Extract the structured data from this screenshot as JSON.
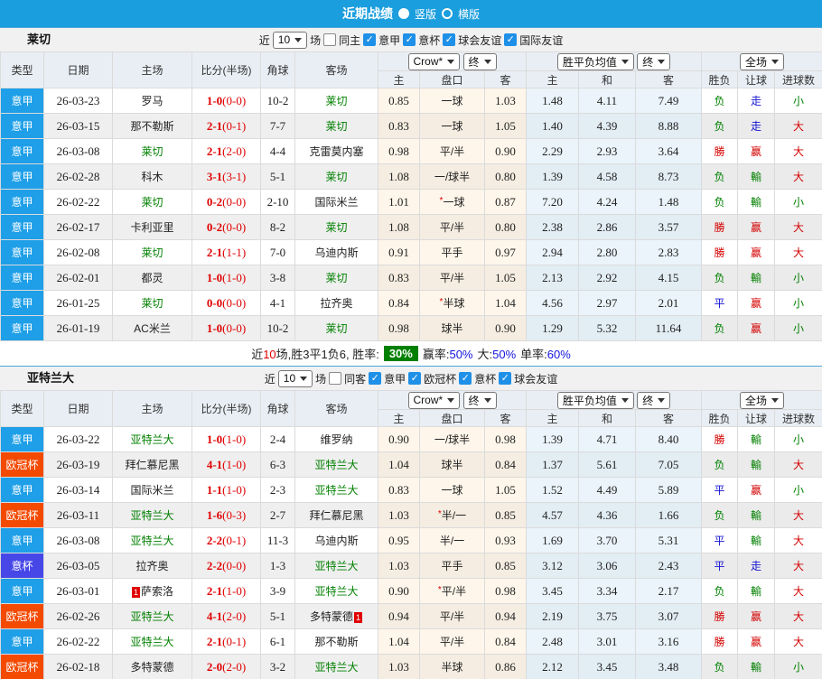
{
  "colors": {
    "titlebar": "#1B9EDE",
    "league": {
      "意甲": "#1E9FE8",
      "欧冠杯": "#F34A00",
      "意杯": "#4747E8"
    },
    "focus_team": "#008000",
    "score": "#E00000",
    "result_red": "#D40000",
    "result_green": "#008000",
    "result_blue": "#1414D4",
    "win_rate_badge": "#008000"
  },
  "title": {
    "text": "近期战绩",
    "vertical_label": "竖版",
    "horizontal_label": "横版"
  },
  "table_header": {
    "cols": [
      "类型",
      "日期",
      "主场",
      "比分(半场)",
      "角球",
      "客场"
    ],
    "sub": [
      "主",
      "盘口",
      "客",
      "主",
      "和",
      "客",
      "胜负",
      "让球",
      "进球数"
    ],
    "dropdowns": {
      "bookmaker": "Crow*",
      "final_a": "终",
      "average": "胜平负均值",
      "final_b": "终",
      "scope": "全场"
    }
  },
  "sections": [
    {
      "team": "莱切",
      "filters": {
        "near": "近",
        "count": "10",
        "games": "场",
        "same": "同主",
        "leagues": [
          "意甲",
          "意杯",
          "球会友谊",
          "国际友谊"
        ]
      },
      "rows": [
        {
          "league": "意甲",
          "date": "26-03-23",
          "home": "罗马",
          "score": "1-0",
          "half": "(0-0)",
          "corner": "10-2",
          "away": "莱切",
          "away_focus": true,
          "odds_home": "0.85",
          "handicap": "一球",
          "odds_away": "1.03",
          "avg_win": "1.48",
          "avg_draw": "4.11",
          "avg_lose": "7.49",
          "res_outcome": "负",
          "res_handicap": "走",
          "res_goals": "小"
        },
        {
          "league": "意甲",
          "date": "26-03-15",
          "home": "那不勒斯",
          "score": "2-1",
          "half": "(0-1)",
          "corner": "7-7",
          "away": "莱切",
          "away_focus": true,
          "odds_home": "0.83",
          "handicap": "一球",
          "odds_away": "1.05",
          "avg_win": "1.40",
          "avg_draw": "4.39",
          "avg_lose": "8.88",
          "res_outcome": "负",
          "res_handicap": "走",
          "res_goals": "大"
        },
        {
          "league": "意甲",
          "date": "26-03-08",
          "home": "莱切",
          "home_focus": true,
          "score": "2-1",
          "half": "(2-0)",
          "corner": "4-4",
          "away": "克雷莫内塞",
          "odds_home": "0.98",
          "handicap": "平/半",
          "odds_away": "0.90",
          "avg_win": "2.29",
          "avg_draw": "2.93",
          "avg_lose": "3.64",
          "res_outcome": "勝",
          "res_handicap": "赢",
          "res_goals": "大"
        },
        {
          "league": "意甲",
          "date": "26-02-28",
          "home": "科木",
          "score": "3-1",
          "half": "(3-1)",
          "corner": "5-1",
          "away": "莱切",
          "away_focus": true,
          "odds_home": "1.08",
          "handicap": "一/球半",
          "odds_away": "0.80",
          "avg_win": "1.39",
          "avg_draw": "4.58",
          "avg_lose": "8.73",
          "res_outcome": "负",
          "res_handicap": "輸",
          "res_goals": "大"
        },
        {
          "league": "意甲",
          "date": "26-02-22",
          "home": "莱切",
          "home_focus": true,
          "score": "0-2",
          "half": "(0-0)",
          "corner": "2-10",
          "away": "国际米兰",
          "odds_home": "1.01",
          "handicap": "一球",
          "handicap_star": true,
          "odds_away": "0.87",
          "avg_win": "7.20",
          "avg_draw": "4.24",
          "avg_lose": "1.48",
          "res_outcome": "负",
          "res_handicap": "輸",
          "res_goals": "小"
        },
        {
          "league": "意甲",
          "date": "26-02-17",
          "home": "卡利亚里",
          "score": "0-2",
          "half": "(0-0)",
          "corner": "8-2",
          "away": "莱切",
          "away_focus": true,
          "odds_home": "1.08",
          "handicap": "平/半",
          "odds_away": "0.80",
          "avg_win": "2.38",
          "avg_draw": "2.86",
          "avg_lose": "3.57",
          "res_outcome": "勝",
          "res_handicap": "赢",
          "res_goals": "大"
        },
        {
          "league": "意甲",
          "date": "26-02-08",
          "home": "莱切",
          "home_focus": true,
          "score": "2-1",
          "half": "(1-1)",
          "corner": "7-0",
          "away": "乌迪内斯",
          "odds_home": "0.91",
          "handicap": "平手",
          "odds_away": "0.97",
          "avg_win": "2.94",
          "avg_draw": "2.80",
          "avg_lose": "2.83",
          "res_outcome": "勝",
          "res_handicap": "赢",
          "res_goals": "大"
        },
        {
          "league": "意甲",
          "date": "26-02-01",
          "home": "都灵",
          "score": "1-0",
          "half": "(1-0)",
          "corner": "3-8",
          "away": "莱切",
          "away_focus": true,
          "odds_home": "0.83",
          "handicap": "平/半",
          "odds_away": "1.05",
          "avg_win": "2.13",
          "avg_draw": "2.92",
          "avg_lose": "4.15",
          "res_outcome": "负",
          "res_handicap": "輸",
          "res_goals": "小"
        },
        {
          "league": "意甲",
          "date": "26-01-25",
          "home": "莱切",
          "home_focus": true,
          "score": "0-0",
          "half": "(0-0)",
          "corner": "4-1",
          "away": "拉齐奥",
          "odds_home": "0.84",
          "handicap": "半球",
          "handicap_star": true,
          "odds_away": "1.04",
          "avg_win": "4.56",
          "avg_draw": "2.97",
          "avg_lose": "2.01",
          "res_outcome": "平",
          "res_handicap": "赢",
          "res_goals": "小"
        },
        {
          "league": "意甲",
          "date": "26-01-19",
          "home": "AC米兰",
          "score": "1-0",
          "half": "(0-0)",
          "corner": "10-2",
          "away": "莱切",
          "away_focus": true,
          "odds_home": "0.98",
          "handicap": "球半",
          "odds_away": "0.90",
          "avg_win": "1.29",
          "avg_draw": "5.32",
          "avg_lose": "11.64",
          "res_outcome": "负",
          "res_handicap": "赢",
          "res_goals": "小"
        }
      ],
      "summary": {
        "near": "近",
        "count": "10",
        "mid": "场,胜3平1负6, 胜率:",
        "win_rate": "30%",
        "parts": [
          {
            "label": "赢率:",
            "value": "50%"
          },
          {
            "label": "大:",
            "value": "50%"
          },
          {
            "label": "单率:",
            "value": "60%"
          }
        ]
      }
    },
    {
      "team": "亚特兰大",
      "filters": {
        "near": "近",
        "count": "10",
        "games": "场",
        "same": "同客",
        "leagues": [
          "意甲",
          "欧冠杯",
          "意杯",
          "球会友谊"
        ]
      },
      "rows": [
        {
          "league": "意甲",
          "date": "26-03-22",
          "home": "亚特兰大",
          "home_focus": true,
          "score": "1-0",
          "half": "(1-0)",
          "corner": "2-4",
          "away": "维罗纳",
          "odds_home": "0.90",
          "handicap": "一/球半",
          "odds_away": "0.98",
          "avg_win": "1.39",
          "avg_draw": "4.71",
          "avg_lose": "8.40",
          "res_outcome": "勝",
          "res_handicap": "輸",
          "res_goals": "小"
        },
        {
          "league": "欧冠杯",
          "date": "26-03-19",
          "home": "拜仁慕尼黑",
          "score": "4-1",
          "half": "(1-0)",
          "corner": "6-3",
          "away": "亚特兰大",
          "away_focus": true,
          "odds_home": "1.04",
          "handicap": "球半",
          "odds_away": "0.84",
          "avg_win": "1.37",
          "avg_draw": "5.61",
          "avg_lose": "7.05",
          "res_outcome": "负",
          "res_handicap": "輸",
          "res_goals": "大"
        },
        {
          "league": "意甲",
          "date": "26-03-14",
          "home": "国际米兰",
          "score": "1-1",
          "half": "(1-0)",
          "corner": "2-3",
          "away": "亚特兰大",
          "away_focus": true,
          "odds_home": "0.83",
          "handicap": "一球",
          "odds_away": "1.05",
          "avg_win": "1.52",
          "avg_draw": "4.49",
          "avg_lose": "5.89",
          "res_outcome": "平",
          "res_handicap": "赢",
          "res_goals": "小"
        },
        {
          "league": "欧冠杯",
          "date": "26-03-11",
          "home": "亚特兰大",
          "home_focus": true,
          "score": "1-6",
          "half": "(0-3)",
          "corner": "2-7",
          "away": "拜仁慕尼黑",
          "odds_home": "1.03",
          "handicap": "半/一",
          "handicap_star": true,
          "odds_away": "0.85",
          "avg_win": "4.57",
          "avg_draw": "4.36",
          "avg_lose": "1.66",
          "res_outcome": "负",
          "res_handicap": "輸",
          "res_goals": "大"
        },
        {
          "league": "意甲",
          "date": "26-03-08",
          "home": "亚特兰大",
          "home_focus": true,
          "score": "2-2",
          "half": "(0-1)",
          "corner": "11-3",
          "away": "乌迪内斯",
          "odds_home": "0.95",
          "handicap": "半/一",
          "odds_away": "0.93",
          "avg_win": "1.69",
          "avg_draw": "3.70",
          "avg_lose": "5.31",
          "res_outcome": "平",
          "res_handicap": "輸",
          "res_goals": "大"
        },
        {
          "league": "意杯",
          "date": "26-03-05",
          "home": "拉齐奥",
          "score": "2-2",
          "half": "(0-0)",
          "corner": "1-3",
          "away": "亚特兰大",
          "away_focus": true,
          "odds_home": "1.03",
          "handicap": "平手",
          "odds_away": "0.85",
          "avg_win": "3.12",
          "avg_draw": "3.06",
          "avg_lose": "2.43",
          "res_outcome": "平",
          "res_handicap": "走",
          "res_goals": "大"
        },
        {
          "league": "意甲",
          "date": "26-03-01",
          "home": "萨索洛",
          "home_card": "1",
          "home_card_side": "left",
          "score": "2-1",
          "half": "(1-0)",
          "corner": "3-9",
          "away": "亚特兰大",
          "away_focus": true,
          "odds_home": "0.90",
          "handicap": "平/半",
          "handicap_star": true,
          "odds_away": "0.98",
          "avg_win": "3.45",
          "avg_draw": "3.34",
          "avg_lose": "2.17",
          "res_outcome": "负",
          "res_handicap": "輸",
          "res_goals": "大"
        },
        {
          "league": "欧冠杯",
          "date": "26-02-26",
          "home": "亚特兰大",
          "home_focus": true,
          "score": "4-1",
          "half": "(2-0)",
          "corner": "5-1",
          "away": "多特蒙德",
          "away_card": "1",
          "away_card_side": "right",
          "odds_home": "0.94",
          "handicap": "平/半",
          "odds_away": "0.94",
          "avg_win": "2.19",
          "avg_draw": "3.75",
          "avg_lose": "3.07",
          "res_outcome": "勝",
          "res_handicap": "赢",
          "res_goals": "大"
        },
        {
          "league": "意甲",
          "date": "26-02-22",
          "home": "亚特兰大",
          "home_focus": true,
          "score": "2-1",
          "half": "(0-1)",
          "corner": "6-1",
          "away": "那不勒斯",
          "odds_home": "1.04",
          "handicap": "平/半",
          "odds_away": "0.84",
          "avg_win": "2.48",
          "avg_draw": "3.01",
          "avg_lose": "3.16",
          "res_outcome": "勝",
          "res_handicap": "赢",
          "res_goals": "大"
        },
        {
          "league": "欧冠杯",
          "date": "26-02-18",
          "home": "多特蒙德",
          "score": "2-0",
          "half": "(2-0)",
          "corner": "3-2",
          "away": "亚特兰大",
          "away_focus": true,
          "odds_home": "1.03",
          "handicap": "半球",
          "odds_away": "0.86",
          "avg_win": "2.12",
          "avg_draw": "3.45",
          "avg_lose": "3.48",
          "res_outcome": "负",
          "res_handicap": "輸",
          "res_goals": "小"
        }
      ]
    }
  ]
}
